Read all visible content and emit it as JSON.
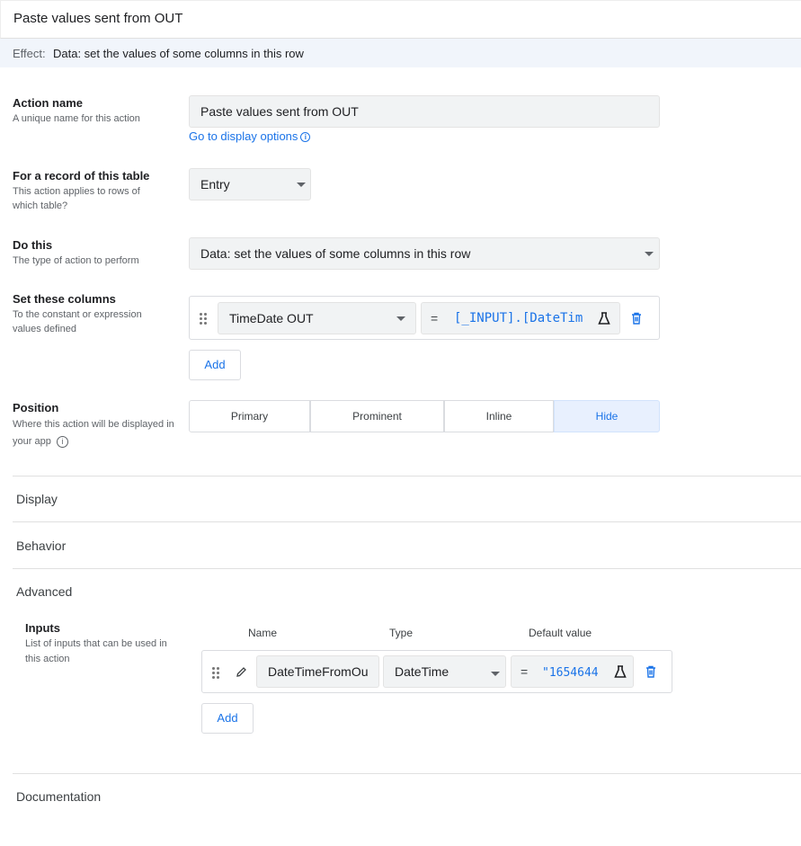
{
  "header": {
    "title": "Paste values sent from OUT"
  },
  "effect": {
    "label": "Effect:",
    "value": "Data: set the values of some columns in this row"
  },
  "action_name": {
    "label": "Action name",
    "help": "A unique name for this action",
    "value": "Paste values sent from OUT",
    "display_link": "Go to display options"
  },
  "record_table": {
    "label": "For a record of this table",
    "help": "This action applies to rows of which table?",
    "value": "Entry"
  },
  "do_this": {
    "label": "Do this",
    "help": "The type of action to perform",
    "value": "Data: set the values of some columns in this row"
  },
  "set_columns": {
    "label": "Set these columns",
    "help": "To the constant or expression values defined",
    "rows": [
      {
        "column": "TimeDate OUT",
        "eq": "=",
        "expression": "[_INPUT].[DateTim"
      }
    ],
    "add_label": "Add"
  },
  "position": {
    "label": "Position",
    "help": "Where this action will be displayed in your app",
    "options": [
      "Primary",
      "Prominent",
      "Inline",
      "Hide"
    ],
    "selected": "Hide"
  },
  "sections": {
    "display": "Display",
    "behavior": "Behavior",
    "advanced": "Advanced",
    "documentation": "Documentation"
  },
  "inputs": {
    "label": "Inputs",
    "help": "List of inputs that can be used in this action",
    "columns": {
      "name": "Name",
      "type": "Type",
      "default": "Default value"
    },
    "rows": [
      {
        "name": "DateTimeFromOu",
        "type": "DateTime",
        "eq": "=",
        "default": "\"1654644"
      }
    ],
    "add_label": "Add"
  },
  "icons": [
    "info-icon",
    "dropdown-caret-icon",
    "drag-handle-icon",
    "flask-icon",
    "trash-icon",
    "pencil-icon"
  ],
  "colors": {
    "accent": "#1a73e8",
    "effect_bg": "#f1f5fb",
    "field_bg": "#f1f3f4",
    "selected_bg": "#e8f0fe"
  }
}
